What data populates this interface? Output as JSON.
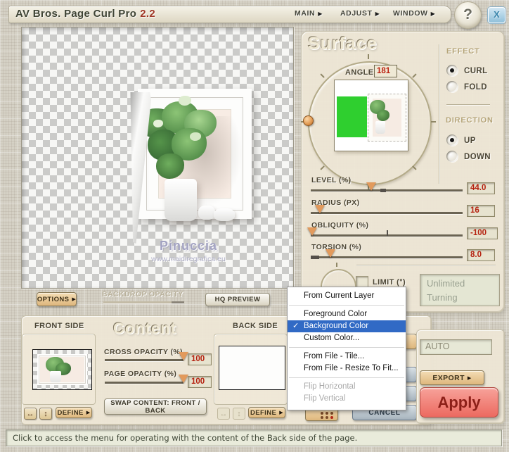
{
  "window": {
    "title": "AV Bros. Page Curl Pro",
    "version": "2.2",
    "menus": [
      {
        "label": "MAIN"
      },
      {
        "label": "ADJUST"
      },
      {
        "label": "WINDOW"
      }
    ],
    "help_label": "?",
    "close_label": "X"
  },
  "icons": {
    "menu_arrow": "▶",
    "checkmark": "✓",
    "h_arrows": "↔",
    "v_arrows": "↕"
  },
  "preview": {
    "watermark_title": "Pinuccia",
    "watermark_url": "www.maidiregrafica.eu",
    "options_button": "OPTIONS",
    "backdrop_opacity_label": "BACKDROP OPACITY",
    "hq_preview_button": "HQ PREVIEW"
  },
  "surface": {
    "title": "Surface",
    "angle_label": "ANGLE",
    "angle_value": "181",
    "effect_label": "EFFECT",
    "effect_options": [
      {
        "label": "CURL",
        "selected": true
      },
      {
        "label": "FOLD",
        "selected": false
      }
    ],
    "direction_label": "DIRECTION",
    "direction_options": [
      {
        "label": "UP",
        "selected": true
      },
      {
        "label": "DOWN",
        "selected": false
      }
    ],
    "sliders": [
      {
        "label": "LEVEL (%)",
        "value": "44.0",
        "position_pct": 40
      },
      {
        "label": "RADIUS (PX)",
        "value": "16",
        "position_pct": 6
      },
      {
        "label": "OBLIQUITY (%)",
        "value": "-100",
        "position_pct": 0
      },
      {
        "label": "TORSION (%)",
        "value": "8.0",
        "position_pct": 13
      }
    ],
    "limit_label": "LIMIT (°)",
    "limit_checked": false,
    "limit_display_line1": "Unlimited",
    "limit_display_line2": "Turning"
  },
  "content": {
    "title": "Content",
    "front_label": "FRONT SIDE",
    "back_label": "BACK SIDE",
    "cross_opacity_label": "CROSS OPACITY (%)",
    "cross_opacity_value": "100",
    "page_opacity_label": "PAGE OPACITY (%)",
    "page_opacity_value": "100",
    "swap_button": "SWAP CONTENT: FRONT / BACK",
    "define_button": "DEFINE"
  },
  "context_menu": {
    "items": [
      {
        "label": "From Current Layer"
      },
      {
        "label": "Foreground Color"
      },
      {
        "label": "Background Color",
        "checked": true,
        "highlighted": true
      },
      {
        "label": "Custom Color..."
      },
      {
        "label": "From File - Tile..."
      },
      {
        "label": "From File - Resize To Fit..."
      },
      {
        "label": "Flip Horizontal",
        "disabled": true
      },
      {
        "label": "Flip Vertical",
        "disabled": true
      }
    ]
  },
  "actions": {
    "auto_label": "AUTO",
    "export_button": "EXPORT",
    "apply_button": "Apply",
    "cancel_button": "CANCEL"
  },
  "status_bar": "Click to access the menu for operating with the content of the Back side of the page.",
  "colors": {
    "menu_highlight": "#316ac5",
    "value_text": "#b52210",
    "apply_red": "#ec6a60",
    "back_fill_green": "#2fcf2f"
  }
}
